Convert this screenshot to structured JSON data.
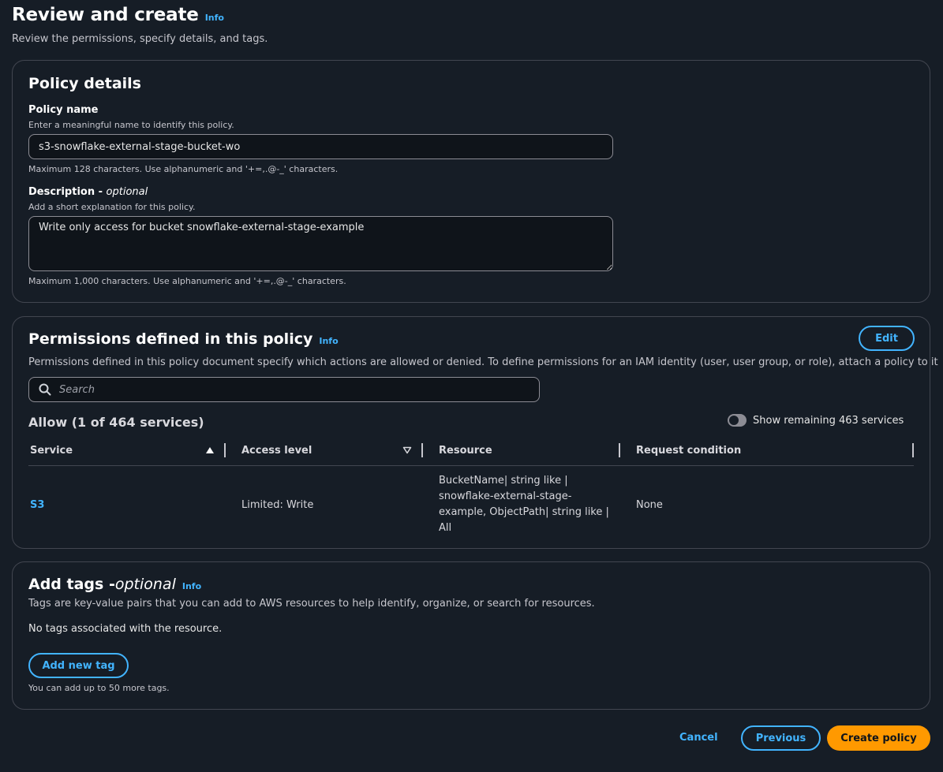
{
  "header": {
    "title": "Review and create",
    "info": "Info",
    "subtitle": "Review the permissions, specify details, and tags."
  },
  "policy_details": {
    "title": "Policy details",
    "name_label": "Policy name",
    "name_hint": "Enter a meaningful name to identify this policy.",
    "name_value": "s3-snowflake-external-stage-bucket-wo",
    "name_constraint": "Maximum 128 characters. Use alphanumeric and '+=,.@-_' characters.",
    "desc_label": "Description - ",
    "desc_optional": "optional",
    "desc_hint": "Add a short explanation for this policy.",
    "desc_value": "Write only access for bucket snowflake-external-stage-example",
    "desc_constraint": "Maximum 1,000 characters. Use alphanumeric and '+=,.@-_' characters."
  },
  "permissions": {
    "title": "Permissions defined in this policy",
    "info": "Info",
    "edit_label": "Edit",
    "description": "Permissions defined in this policy document specify which actions are allowed or denied. To define permissions for an IAM identity (user, user group, or role), attach a policy to it",
    "search_placeholder": "Search",
    "allow_heading": "Allow (1 of 464 services)",
    "toggle_label": "Show remaining 463 services",
    "toggle_on": false,
    "columns": {
      "service": "Service",
      "access_level": "Access level",
      "resource": "Resource",
      "request_condition": "Request condition"
    },
    "rows": [
      {
        "service": "S3",
        "access_level": "Limited: Write",
        "resource_lines": [
          "BucketName| string like |",
          "snowflake-external-stage-",
          "example, ObjectPath| string like |",
          "All"
        ],
        "request_condition": "None"
      }
    ]
  },
  "tags": {
    "title": "Add tags - ",
    "optional": "optional",
    "info": "Info",
    "description": "Tags are key-value pairs that you can add to AWS resources to help identify, organize, or search for resources.",
    "empty_text": "No tags associated with the resource.",
    "add_button": "Add new tag",
    "limit_hint": "You can add up to 50 more tags."
  },
  "footer": {
    "cancel": "Cancel",
    "previous": "Previous",
    "create": "Create policy"
  },
  "colors": {
    "background": "#161d26",
    "border": "#424650",
    "link": "#42b4ff",
    "primary": "#ff9900"
  }
}
